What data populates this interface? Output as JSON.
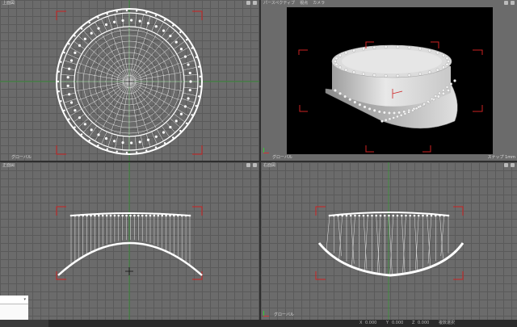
{
  "viewports": {
    "top": {
      "title": "上面図",
      "footer": "グローバル"
    },
    "perspective": {
      "title": "パースペクティブ",
      "mode": "視点",
      "view": "カメラ",
      "footer": "グローバル",
      "footer_right": "スナップ 1mm"
    },
    "front": {
      "title": "正面図",
      "footer": "グローバル"
    },
    "side": {
      "title": "右面図",
      "footer": "グローバル"
    }
  },
  "statusbar": {
    "coords": [
      "0.000",
      "0.000",
      "0.000"
    ],
    "labels": [
      "X",
      "Y",
      "Z"
    ],
    "extra": "複数選択"
  },
  "colors": {
    "grid_bg": "#6b6b6b",
    "accent_red": "#cc2222",
    "axis_green": "#2f9e2f",
    "wire": "#ffffff"
  },
  "icons": {
    "viewport_menu": "gear-icon",
    "axis_gizmo": "axis-gizmo-icon"
  }
}
